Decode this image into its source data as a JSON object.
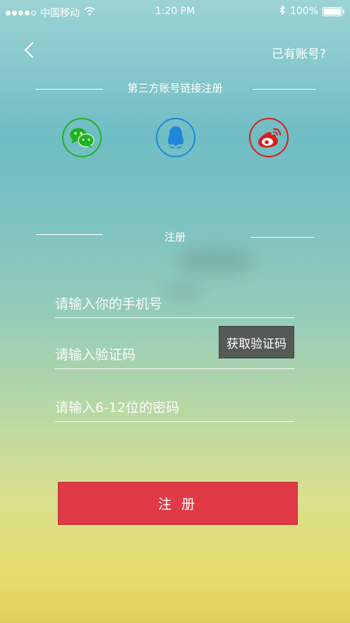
{
  "status_bar": {
    "carrier": "中国移动",
    "time": "1:20 PM",
    "battery": "100%"
  },
  "header": {
    "back_icon": "chevron-left-icon",
    "have_account": "已有账号?"
  },
  "third_party": {
    "title": "第三方账号链接注册",
    "providers": [
      {
        "name": "wechat",
        "icon": "wechat-icon",
        "color": "#1fb222"
      },
      {
        "name": "qq",
        "icon": "qq-icon",
        "color": "#1e88d8"
      },
      {
        "name": "weibo",
        "icon": "weibo-icon",
        "color": "#d91e1e"
      }
    ]
  },
  "register": {
    "title": "注册",
    "phone_placeholder": "请输入你的手机号",
    "code_placeholder": "请输入验证码",
    "get_code_label": "获取验证码",
    "password_placeholder": "请输入6-12位的密码",
    "submit_label": "注 册"
  },
  "colors": {
    "accent": "#e03a47",
    "code_button": "#545b55"
  }
}
